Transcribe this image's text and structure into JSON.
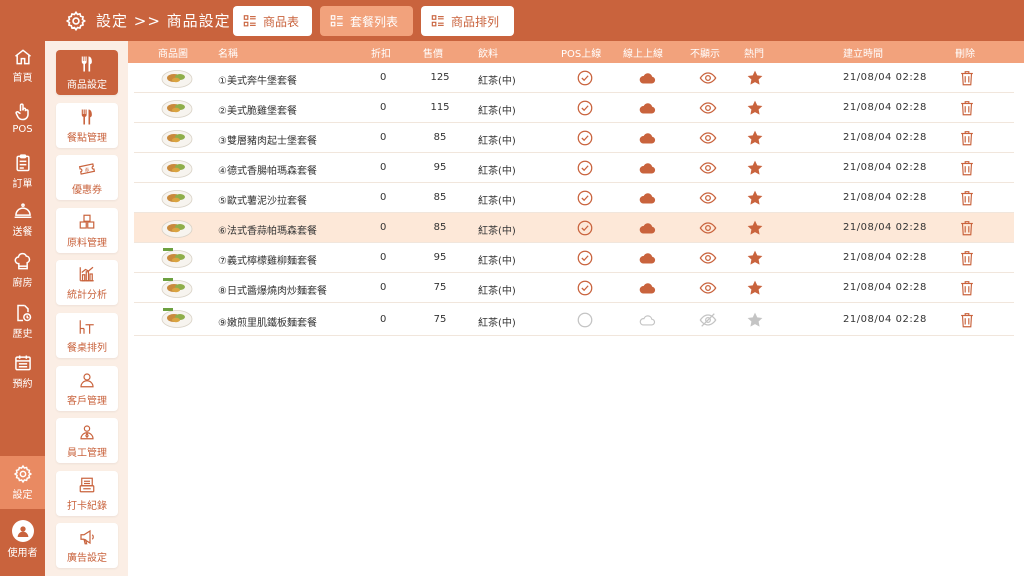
{
  "header": {
    "breadcrumb": "設定 >> 商品設定",
    "tabs": [
      {
        "label": "商品表",
        "active": false
      },
      {
        "label": "套餐列表",
        "active": true
      },
      {
        "label": "商品排列",
        "active": false
      }
    ]
  },
  "rail": {
    "items": [
      {
        "label": "首頁",
        "icon": "home-icon"
      },
      {
        "label": "POS",
        "icon": "hand-pointer-icon"
      },
      {
        "label": "訂單",
        "icon": "clipboard-icon"
      },
      {
        "label": "送餐",
        "icon": "cloche-icon"
      },
      {
        "label": "廚房",
        "icon": "chef-hat-icon"
      },
      {
        "label": "歷史",
        "icon": "history-doc-icon"
      },
      {
        "label": "預約",
        "icon": "calendar-icon"
      }
    ],
    "settings_label": "設定",
    "user_label": "使用者"
  },
  "sidebar": {
    "items": [
      {
        "label": "商品設定",
        "icon": "utensils-icon",
        "active": true
      },
      {
        "label": "餐點管理",
        "icon": "utensils-icon",
        "active": false
      },
      {
        "label": "優惠券",
        "icon": "coupon-icon",
        "active": false
      },
      {
        "label": "原料管理",
        "icon": "boxes-icon",
        "active": false
      },
      {
        "label": "統計分析",
        "icon": "bar-chart-icon",
        "active": false
      },
      {
        "label": "餐桌排列",
        "icon": "table-chair-icon",
        "active": false
      },
      {
        "label": "客戶管理",
        "icon": "person-icon",
        "active": false
      },
      {
        "label": "員工管理",
        "icon": "employee-icon",
        "active": false
      },
      {
        "label": "打卡紀錄",
        "icon": "punch-clock-icon",
        "active": false
      },
      {
        "label": "廣告設定",
        "icon": "megaphone-icon",
        "active": false
      }
    ]
  },
  "table": {
    "columns": [
      "商品圖",
      "名稱",
      "折扣",
      "售價",
      "飲料",
      "POS上線",
      "線上上線",
      "不顯示",
      "熱門",
      "建立時間",
      "刪除"
    ],
    "rows": [
      {
        "name": "①美式奔牛堡套餐",
        "discount": "0",
        "price": "125",
        "drink": "紅茶(中)",
        "pos": true,
        "online": true,
        "visible": true,
        "hot": true,
        "created": "21/08/04 02:28",
        "selected": false
      },
      {
        "name": "②美式脆雞堡套餐",
        "discount": "0",
        "price": "115",
        "drink": "紅茶(中)",
        "pos": true,
        "online": true,
        "visible": true,
        "hot": true,
        "created": "21/08/04 02:28",
        "selected": false
      },
      {
        "name": "③雙層豬肉起士堡套餐",
        "discount": "0",
        "price": "85",
        "drink": "紅茶(中)",
        "pos": true,
        "online": true,
        "visible": true,
        "hot": true,
        "created": "21/08/04 02:28",
        "selected": false
      },
      {
        "name": "④德式香腸帕瑪森套餐",
        "discount": "0",
        "price": "95",
        "drink": "紅茶(中)",
        "pos": true,
        "online": true,
        "visible": true,
        "hot": true,
        "created": "21/08/04 02:28",
        "selected": false
      },
      {
        "name": "⑤歐式薯泥沙拉套餐",
        "discount": "0",
        "price": "85",
        "drink": "紅茶(中)",
        "pos": true,
        "online": true,
        "visible": true,
        "hot": true,
        "created": "21/08/04 02:28",
        "selected": false
      },
      {
        "name": "⑥法式香蒜帕瑪森套餐",
        "discount": "0",
        "price": "85",
        "drink": "紅茶(中)",
        "pos": true,
        "online": true,
        "visible": true,
        "hot": true,
        "created": "21/08/04 02:28",
        "selected": true
      },
      {
        "name": "⑦義式檸檬雞柳麵套餐",
        "discount": "0",
        "price": "95",
        "drink": "紅茶(中)",
        "pos": true,
        "online": true,
        "visible": true,
        "hot": true,
        "created": "21/08/04 02:28",
        "selected": false
      },
      {
        "name": "⑧日式醬爆燒肉炒麵套餐",
        "discount": "0",
        "price": "75",
        "drink": "紅茶(中)",
        "pos": true,
        "online": true,
        "visible": true,
        "hot": true,
        "created": "21/08/04 02:28",
        "selected": false
      },
      {
        "name": "⑨嫩煎里肌鐵板麵套餐",
        "discount": "0",
        "price": "75",
        "drink": "紅茶(中)",
        "pos": false,
        "online": false,
        "visible": false,
        "hot": false,
        "created": "21/08/04 02:28",
        "selected": false
      }
    ]
  },
  "colors": {
    "brand": "#c9633d",
    "brand_light": "#f2a27c",
    "sidebar_bg": "#fbeee5",
    "row_selected": "#fde8d8",
    "inactive_icon": "#c4c4c4"
  }
}
